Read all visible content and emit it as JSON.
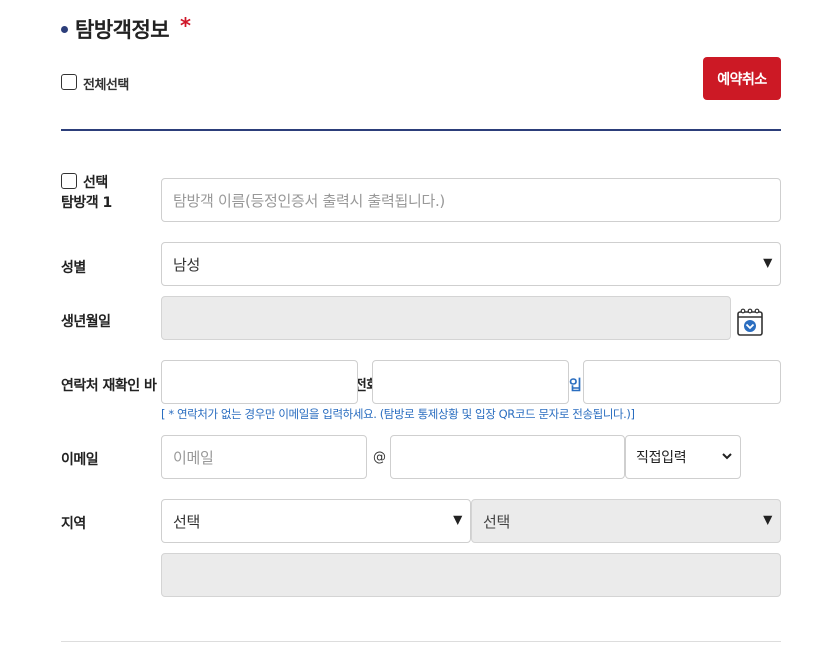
{
  "section": {
    "title": "탐방객정보",
    "required_mark": "*"
  },
  "select_all": {
    "label": "전체선택",
    "checked": false
  },
  "cancel_button": {
    "label": "예약취소"
  },
  "visitor": {
    "select_label": "선택",
    "visitor_label": "탐방객 1",
    "name_placeholder": "탐방객 이름(등정인증서 출력시 출력됩니다.)"
  },
  "gender": {
    "label": "성별",
    "value": "남성"
  },
  "birthdate": {
    "label": "생년월일",
    "value": ""
  },
  "contact": {
    "label": "연락처 재확인 바",
    "partial_label_1": "전화",
    "partial_label_2": "입",
    "note": "[ * 연락처가 없는 경우만 이메일을 입력하세요. (탐방로 통제상황 및 입장 QR코드 문자로 전송됩니다.)]"
  },
  "email": {
    "label": "이메일",
    "local_placeholder": "이메일",
    "at_symbol": "@",
    "domain_value": "",
    "domain_select": "직접입력"
  },
  "region": {
    "label": "지역",
    "province": "선택",
    "district": "선택",
    "detail": ""
  },
  "colors": {
    "accent_navy": "#2c3e7a",
    "cancel_red": "#cc1925",
    "note_blue": "#2b6ec0",
    "disabled_bg": "#ebebeb"
  },
  "icons": [
    "calendar-icon",
    "chevron-down-icon"
  ]
}
